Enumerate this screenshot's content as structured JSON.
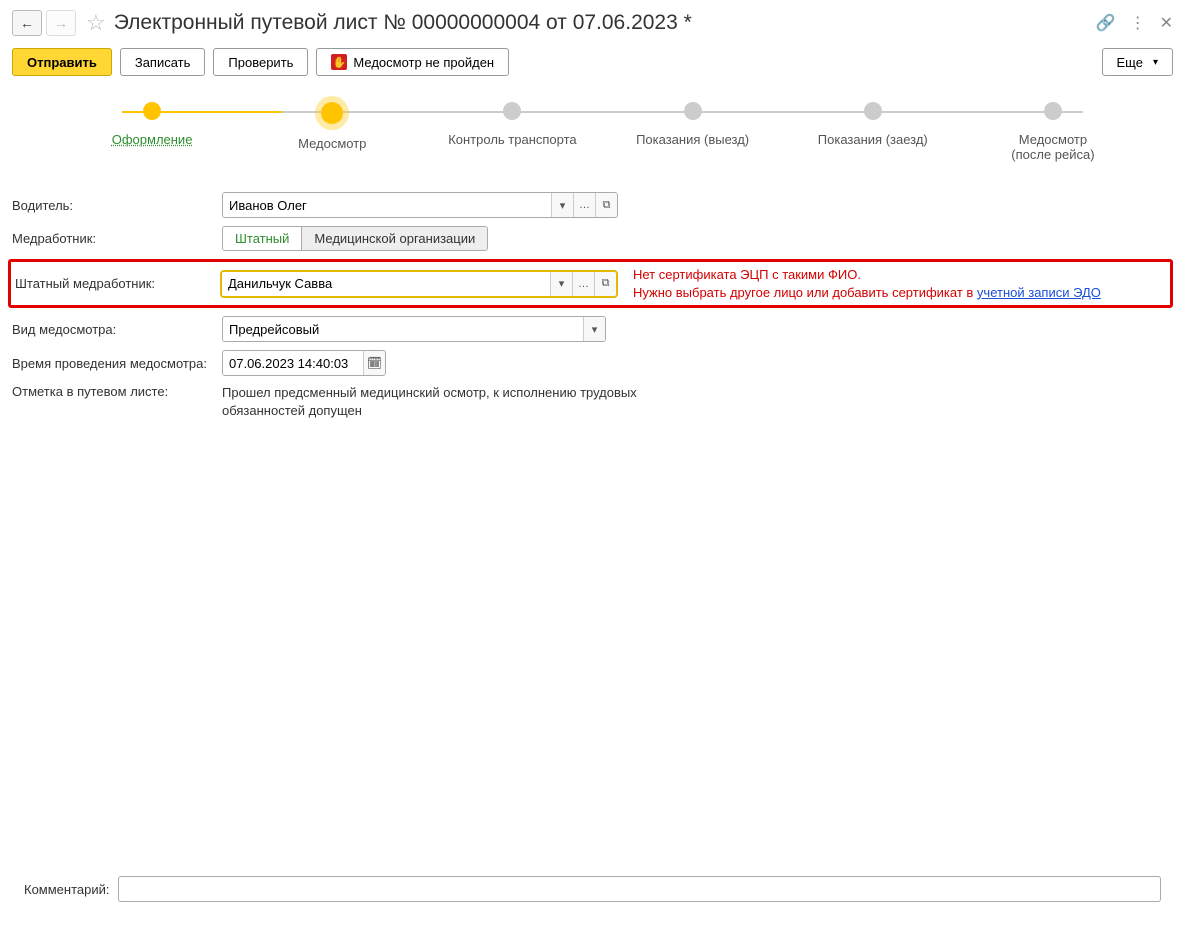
{
  "header": {
    "title": "Электронный путевой лист № 00000000004 от 07.06.2023 *"
  },
  "toolbar": {
    "send": "Отправить",
    "save": "Записать",
    "check": "Проверить",
    "medfail": "Медосмотр не пройден",
    "more": "Еще"
  },
  "stepper": {
    "s1": "Оформление",
    "s2": "Медосмотр",
    "s3": "Контроль транспорта",
    "s4": "Показания (выезд)",
    "s5": "Показания (заезд)",
    "s6": "Медосмотр\n(после рейса)"
  },
  "labels": {
    "driver": "Водитель:",
    "medworker": "Медработник:",
    "staffWorker": "Штатный медработник:",
    "examType": "Вид медосмотра:",
    "examTime": "Время проведения медосмотра:",
    "note": "Отметка в путевом листе:",
    "comment": "Комментарий:"
  },
  "values": {
    "driver": "Иванов Олег",
    "staffWorker": "Данильчук Савва",
    "examType": "Предрейсовый",
    "examTime": "07.06.2023 14:40:03",
    "noteText": "Прошел предсменный медицинский осмотр, к исполнению трудовых обязанностей допущен"
  },
  "toggle": {
    "opt1": "Штатный",
    "opt2": "Медицинской организации"
  },
  "error": {
    "line1": "Нет сертификата ЭЦП с такими ФИО.",
    "line2a": "Нужно выбрать другое лицо или добавить сертификат в ",
    "link": "учетной записи ЭДО"
  }
}
